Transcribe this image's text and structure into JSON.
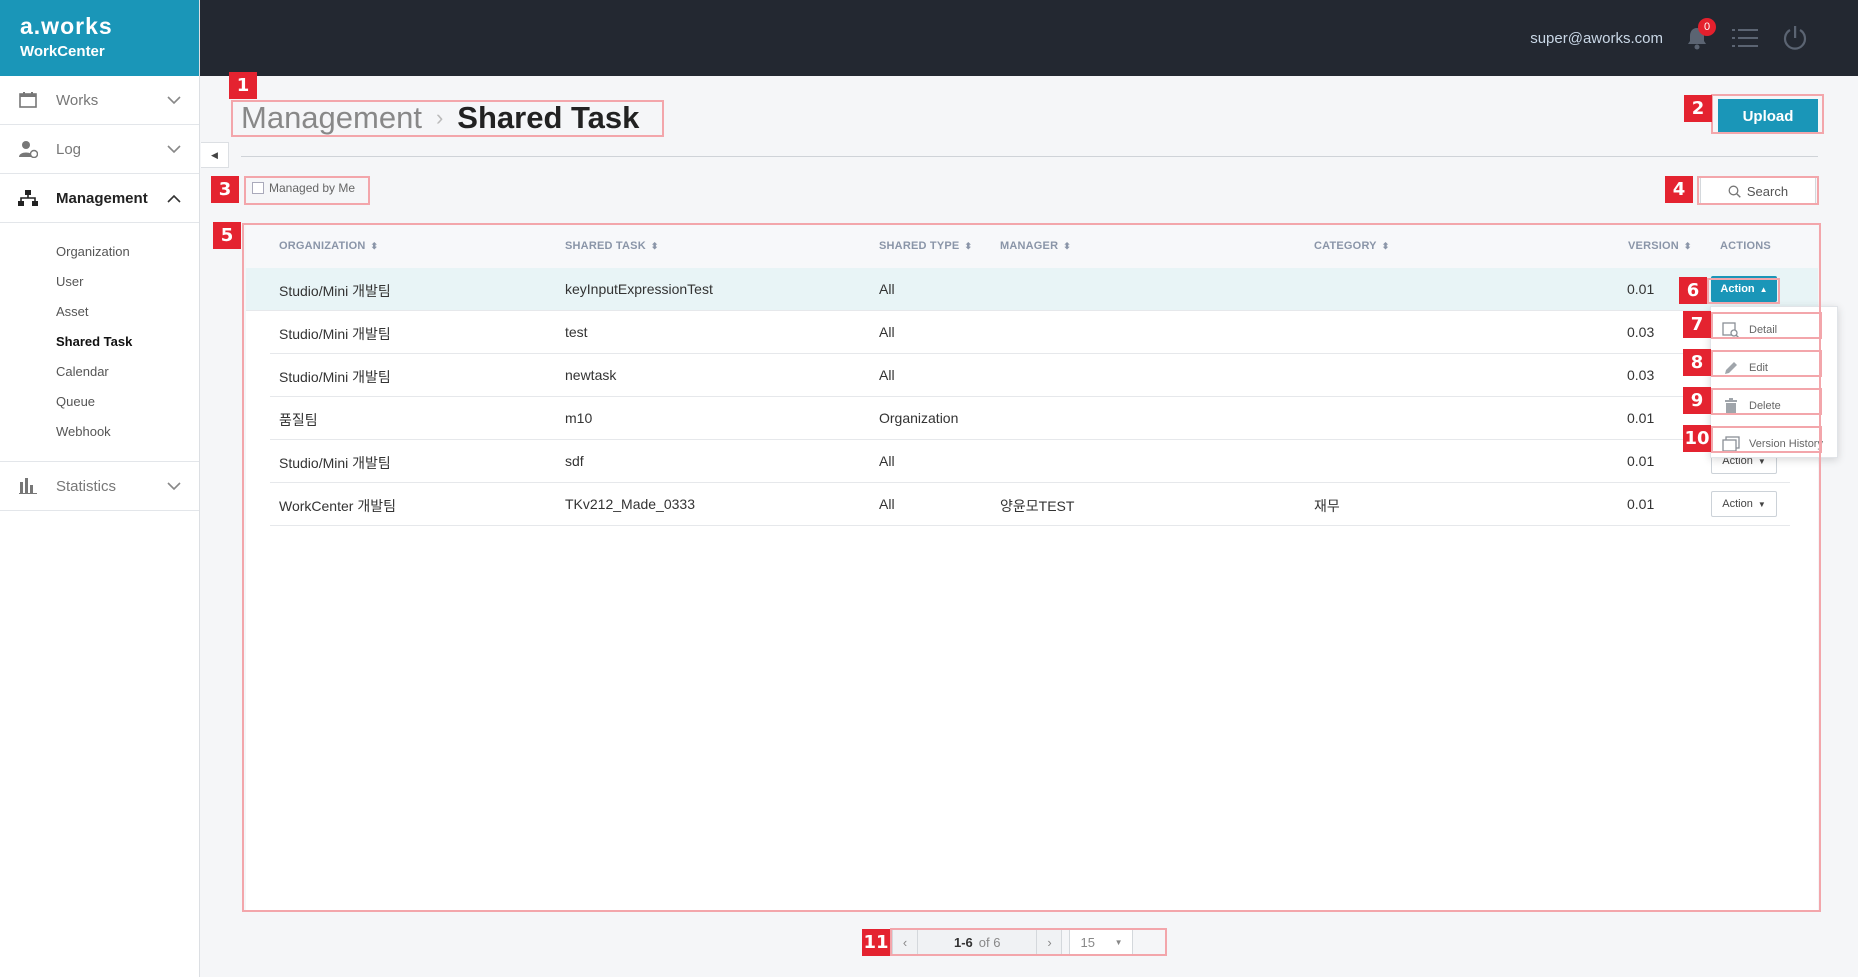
{
  "brand": {
    "logo": "a.works",
    "product": "WorkCenter"
  },
  "header": {
    "user_email": "super@aworks.com",
    "notification_count": "0"
  },
  "sidebar": {
    "items": [
      {
        "label": "Works",
        "icon": "calendar-icon"
      },
      {
        "label": "Log",
        "icon": "user-log-icon"
      },
      {
        "label": "Management",
        "icon": "hierarchy-icon"
      },
      {
        "label": "Statistics",
        "icon": "bar-chart-icon"
      }
    ],
    "management_sub": [
      "Organization",
      "User",
      "Asset",
      "Shared Task",
      "Calendar",
      "Queue",
      "Webhook"
    ],
    "active_sub": "Shared Task"
  },
  "breadcrumb": {
    "parent": "Management",
    "separator": "›",
    "current": "Shared Task"
  },
  "toolbar": {
    "upload_label": "Upload",
    "managed_by_me_label": "Managed by Me",
    "search_label": "Search"
  },
  "table": {
    "columns": [
      "ORGANIZATION",
      "SHARED TASK",
      "SHARED TYPE",
      "MANAGER",
      "CATEGORY",
      "VERSION",
      "ACTIONS"
    ],
    "rows": [
      {
        "organization": "Studio/Mini 개발팀",
        "shared_task": "keyInputExpressionTest",
        "shared_type": "All",
        "manager": "",
        "category": "",
        "version": "0.01",
        "action": "Action"
      },
      {
        "organization": "Studio/Mini 개발팀",
        "shared_task": "test",
        "shared_type": "All",
        "manager": "",
        "category": "",
        "version": "0.03",
        "action": "Action"
      },
      {
        "organization": "Studio/Mini 개발팀",
        "shared_task": "newtask",
        "shared_type": "All",
        "manager": "",
        "category": "",
        "version": "0.03",
        "action": "Action"
      },
      {
        "organization": "품질팀",
        "shared_task": "m10",
        "shared_type": "Organization",
        "manager": "",
        "category": "",
        "version": "0.01",
        "action": "Action"
      },
      {
        "organization": "Studio/Mini 개발팀",
        "shared_task": "sdf",
        "shared_type": "All",
        "manager": "",
        "category": "",
        "version": "0.01",
        "action": "Action"
      },
      {
        "organization": "WorkCenter 개발팀",
        "shared_task": "TKv212_Made_0333",
        "shared_type": "All",
        "manager": "양윤모TEST",
        "category": "재무",
        "version": "0.01",
        "action": "Action"
      }
    ]
  },
  "action_menu": [
    "Detail",
    "Edit",
    "Delete",
    "Version History"
  ],
  "pagination": {
    "range": "1-6",
    "of_label": "of 6",
    "page_size": "15"
  },
  "annotations": [
    "1",
    "2",
    "3",
    "4",
    "5",
    "6",
    "7",
    "8",
    "9",
    "10",
    "11"
  ],
  "colors": {
    "brand": "#1a96b8",
    "topbar": "#232831",
    "marker": "#e42330",
    "highlight": "#f3a6ab"
  }
}
